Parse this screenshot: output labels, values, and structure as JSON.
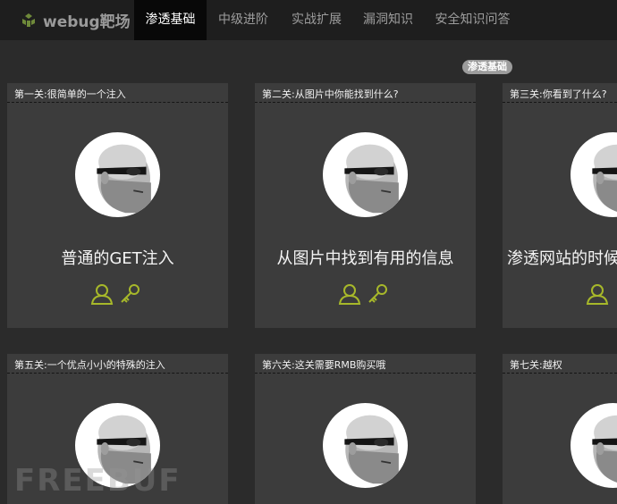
{
  "brand": {
    "name": "webug靶场"
  },
  "nav": {
    "items": [
      "渗透基础",
      "中级进阶",
      "实战扩展",
      "漏洞知识",
      "安全知识问答"
    ]
  },
  "section_badge": "渗透基础",
  "cards": [
    {
      "title": "第一关:很简单的一个注入",
      "name": "普通的GET注入"
    },
    {
      "title": "第二关:从图片中你能找到什么?",
      "name": "从图片中找到有用的信息"
    },
    {
      "title": "第三关:你看到了什么?",
      "name": "渗透网站的时候"
    },
    {
      "title": "第五关:一个优点小小的特殊的注入",
      "name": ""
    },
    {
      "title": "第六关:这关需要RMB购买哦",
      "name": ""
    },
    {
      "title": "第七关:越权",
      "name": ""
    }
  ],
  "watermark": "FREEBUF",
  "colors": {
    "icon_accent": "#a7b82a",
    "nav_active_bg": "#080808"
  }
}
